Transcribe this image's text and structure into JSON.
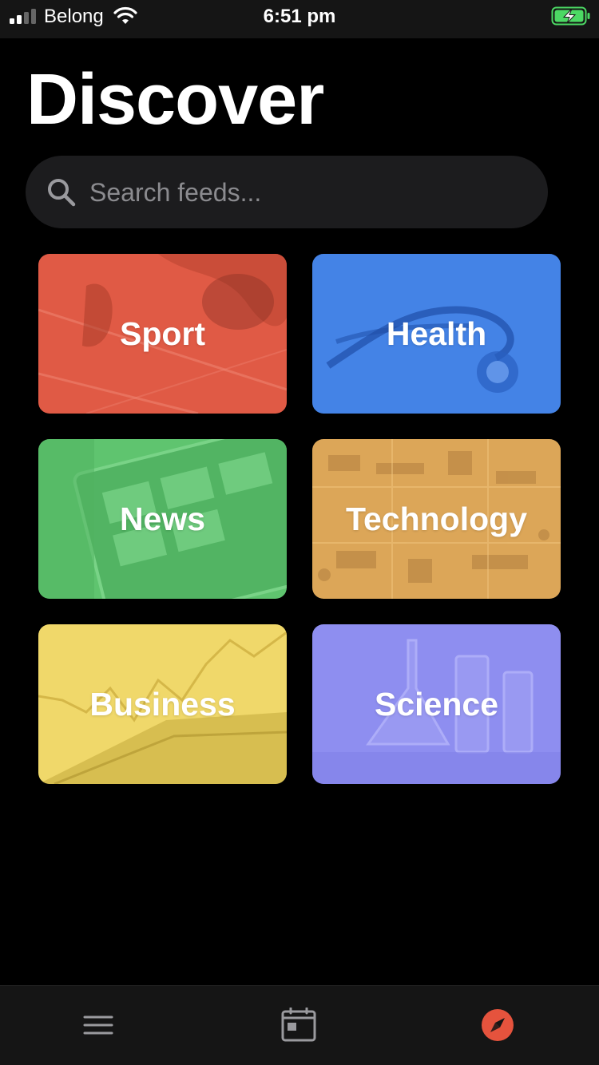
{
  "status_bar": {
    "carrier": "Belong",
    "time": "6:51 pm",
    "signal_icon": "cellular-signal-icon",
    "wifi_icon": "wifi-icon",
    "battery_icon": "battery-charging-icon",
    "battery_color": "#4cd964"
  },
  "header": {
    "title": "Discover"
  },
  "search": {
    "placeholder": "Search feeds...",
    "value": "",
    "icon": "search-icon"
  },
  "categories": [
    {
      "label": "Sport",
      "color": "#e05a45"
    },
    {
      "label": "Health",
      "color": "#3d7ee4"
    },
    {
      "label": "News",
      "color": "#5fc46f"
    },
    {
      "label": "Technology",
      "color": "#dca658"
    },
    {
      "label": "Business",
      "color": "#f0d86a"
    },
    {
      "label": "Science",
      "color": "#8e8ef0"
    }
  ],
  "tab_bar": {
    "tabs": [
      {
        "icon": "list-icon",
        "active": false
      },
      {
        "icon": "calendar-icon",
        "active": false
      },
      {
        "icon": "compass-icon",
        "active": true
      }
    ],
    "accent": "#e5533d"
  }
}
